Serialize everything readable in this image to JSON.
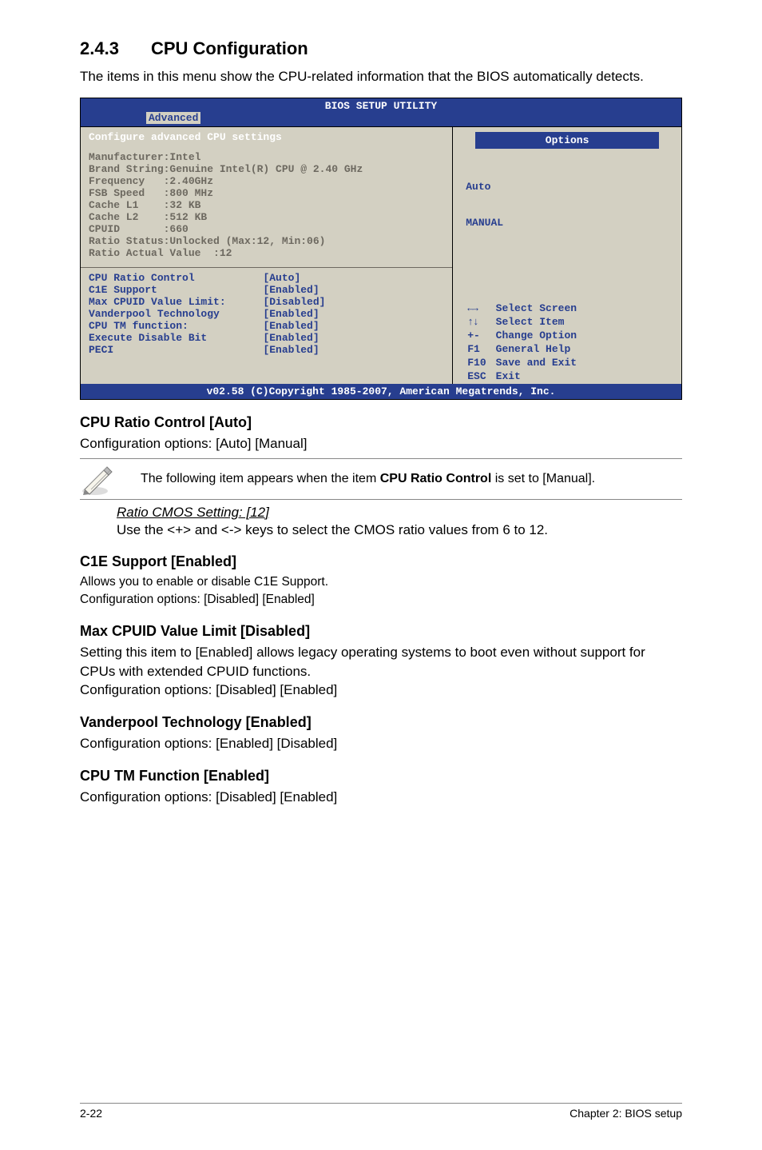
{
  "heading": {
    "number": "2.4.3",
    "title": "CPU Configuration"
  },
  "intro": "The items in this menu show the CPU-related information that the BIOS automatically detects.",
  "bios": {
    "title": "BIOS SETUP UTILITY",
    "tab": "Advanced",
    "left_title": "Configure advanced CPU settings",
    "info": {
      "l1": "Manufacturer:Intel",
      "l2": "Brand String:Genuine Intel(R) CPU @ 2.40 GHz",
      "l3": "Frequency   :2.40GHz",
      "l4": "FSB Speed   :800 MHz",
      "l5": "Cache L1    :32 KB",
      "l6": "Cache L2    :512 KB",
      "l7": "CPUID       :660",
      "l8": "Ratio Status:Unlocked (Max:12, Min:06)",
      "l9": "Ratio Actual Value  :12"
    },
    "settings": {
      "s1": {
        "label": "CPU Ratio Control",
        "value": "[Auto]"
      },
      "s2": {
        "label": "C1E Support",
        "value": "[Enabled]"
      },
      "s3": {
        "label": "Max CPUID Value Limit:",
        "value": "[Disabled]"
      },
      "s4": {
        "label": "Vanderpool Technology",
        "value": "[Enabled]"
      },
      "s5": {
        "label": "CPU TM function:",
        "value": "[Enabled]"
      },
      "s6": {
        "label": "Execute Disable Bit",
        "value": "[Enabled]"
      },
      "s7": {
        "label": "PECI",
        "value": "[Enabled]"
      }
    },
    "right": {
      "options_label": "Options",
      "opt1": "Auto",
      "opt2": "MANUAL",
      "nav": {
        "n1k": "←→",
        "n1v": "Select Screen",
        "n2k": "↑↓",
        "n2v": "Select Item",
        "n3k": "+-",
        "n3v": "Change Option",
        "n4k": "F1",
        "n4v": "General Help",
        "n5k": "F10",
        "n5v": "Save and Exit",
        "n6k": "ESC",
        "n6v": "Exit"
      }
    },
    "footer": "v02.58 (C)Copyright 1985-2007, American Megatrends, Inc."
  },
  "chart_data": {
    "type": "table",
    "title": "Configure advanced CPU settings",
    "rows": [
      {
        "setting": "CPU Ratio Control",
        "value": "Auto"
      },
      {
        "setting": "C1E Support",
        "value": "Enabled"
      },
      {
        "setting": "Max CPUID Value Limit",
        "value": "Disabled"
      },
      {
        "setting": "Vanderpool Technology",
        "value": "Enabled"
      },
      {
        "setting": "CPU TM function",
        "value": "Enabled"
      },
      {
        "setting": "Execute Disable Bit",
        "value": "Enabled"
      },
      {
        "setting": "PECI",
        "value": "Enabled"
      }
    ],
    "options": [
      "Auto",
      "MANUAL"
    ]
  },
  "sections": {
    "cpu_ratio": {
      "title": "CPU Ratio Control [Auto]",
      "body": "Configuration options: [Auto] [Manual]"
    },
    "note": {
      "text_1": "The following item appears when the item ",
      "bold": "CPU Ratio Control",
      "text_2": " is set to [Manual]."
    },
    "ratio_cmos": {
      "title": "Ratio CMOS Setting: [12]",
      "body": "Use the <+> and <-> keys to select the CMOS ratio values from 6 to 12."
    },
    "c1e": {
      "title": "C1E Support [Enabled]",
      "body": "Allows you to enable or disable C1E Support.\nConfiguration options: [Disabled] [Enabled]"
    },
    "max_cpuid": {
      "title": "Max CPUID Value Limit [Disabled]",
      "body": "Setting this item to [Enabled] allows legacy operating systems to boot even without support for CPUs with extended CPUID functions.\nConfiguration options: [Disabled] [Enabled]"
    },
    "vanderpool": {
      "title": "Vanderpool Technology [Enabled]",
      "body": "Configuration options: [Enabled] [Disabled]"
    },
    "cpu_tm": {
      "title": "CPU TM Function [Enabled]",
      "body": "Configuration options: [Disabled] [Enabled]"
    }
  },
  "footer": {
    "left": "2-22",
    "right": "Chapter 2: BIOS setup"
  }
}
